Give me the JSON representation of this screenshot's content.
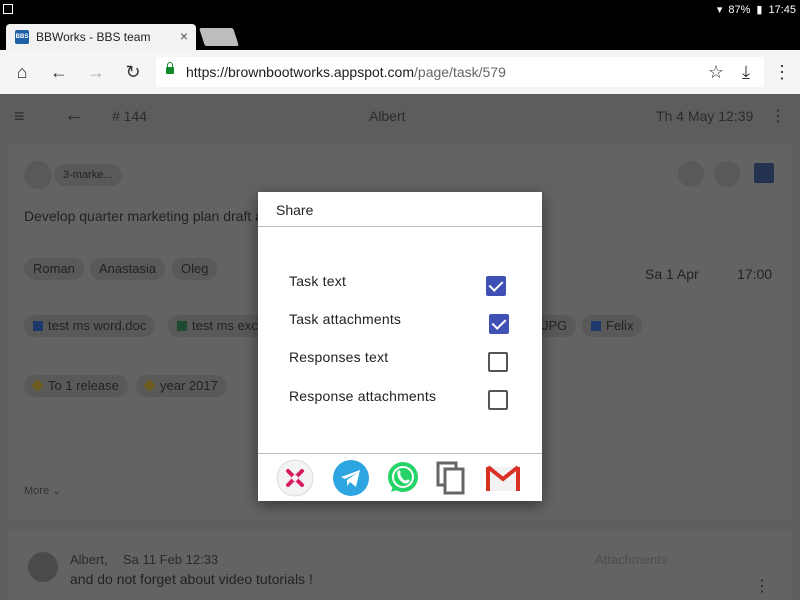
{
  "statusbar": {
    "battery": "87%",
    "time": "17:45"
  },
  "tab": {
    "title": "BBWorks - BBS team",
    "favicon_text": "BBS",
    "close": "×"
  },
  "toolbar": {
    "url_host": "https://brownbootworks.appspot.com",
    "url_path": "/page/task/579"
  },
  "appbar": {
    "task_number": "# 144",
    "user": "Albert",
    "date": "Th 4 May 12:39"
  },
  "task": {
    "folder_chip": "3-marke...",
    "title": "Develop quarter marketing plan draft an",
    "people": [
      "Roman",
      "Anastasia",
      "Oleg"
    ],
    "due_date": "Sa 1 Apr",
    "due_time": "17:00",
    "attachments": [
      "test ms word.doc",
      "test ms exc"
    ],
    "jpg_chip": "JPG",
    "assignee": "Felix",
    "tags": [
      "To 1 release",
      "year 2017"
    ],
    "more": "More"
  },
  "response": {
    "author": "Albert,",
    "date": "Sa 11 Feb 12:33",
    "text": "and do not forget about video tutorials !",
    "attachments_label": "Attachments"
  },
  "dialog": {
    "title": "Share",
    "options": [
      {
        "label": "Task text",
        "checked": true
      },
      {
        "label": "Task attachments",
        "checked": true
      },
      {
        "label": "Responses text",
        "checked": false
      },
      {
        "label": "Response attachments",
        "checked": false
      }
    ],
    "share_targets": [
      "bbworks-icon",
      "telegram-icon",
      "whatsapp-icon",
      "copy-icon",
      "gmail-icon"
    ]
  },
  "colors": {
    "accent": "#3f51b5",
    "telegram": "#2ca5e0",
    "whatsapp": "#25d366",
    "gmail": "#d93025"
  }
}
